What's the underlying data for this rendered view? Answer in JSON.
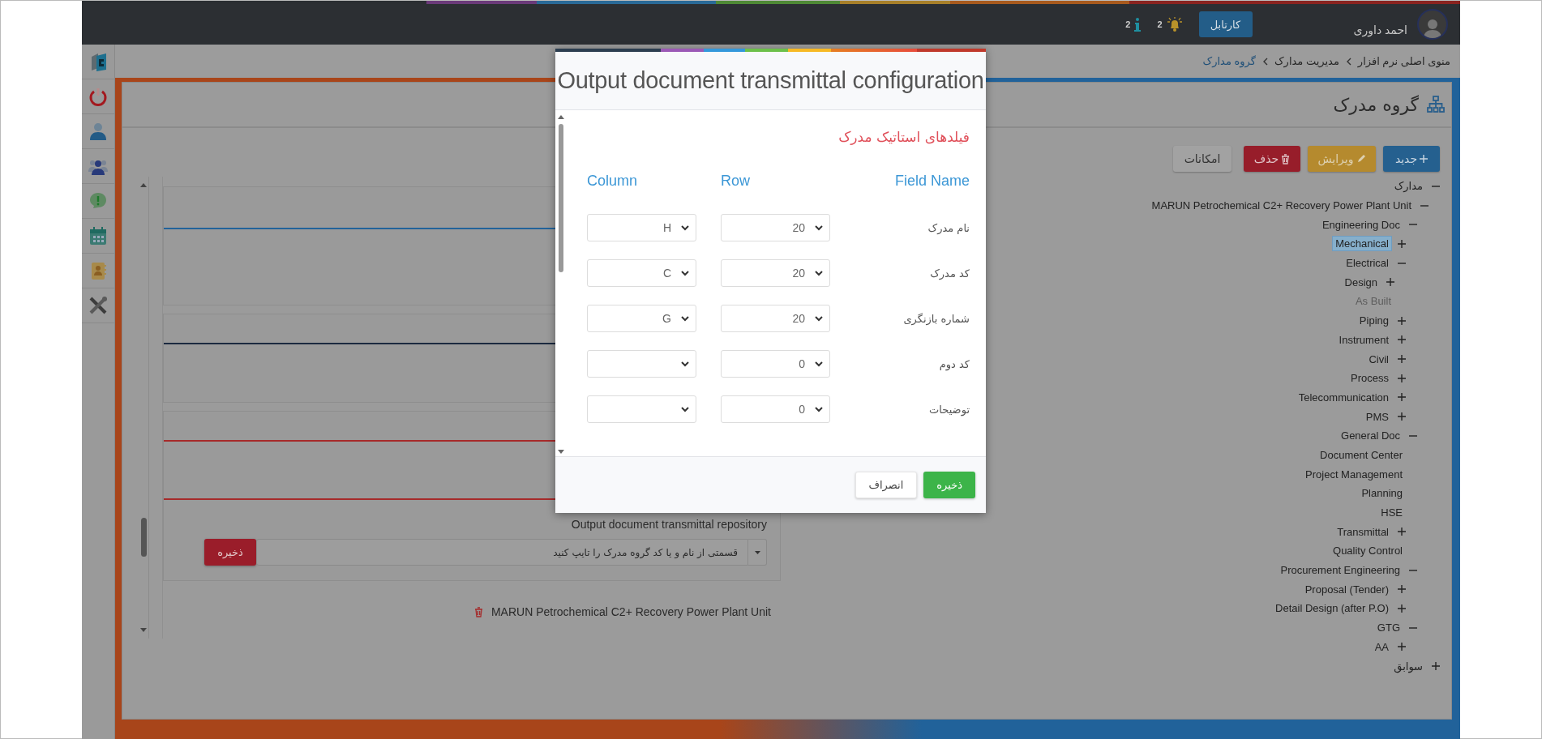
{
  "top_bar": {
    "user_name": "احمد داوری",
    "inbox_button": "کارتابل",
    "notifications_count": "2",
    "info_count": "2"
  },
  "breadcrumb": [
    {
      "label": "منوی اصلی نرم افزار",
      "current": false
    },
    {
      "label": "مدیریت مدارک",
      "current": false
    },
    {
      "label": "گروه مدارک",
      "current": true
    }
  ],
  "page": {
    "title": "گروه مدرک"
  },
  "toolbar": {
    "buttons": [
      {
        "kind": "new",
        "label": "جدید"
      },
      {
        "kind": "edit",
        "label": "ویرایش"
      },
      {
        "kind": "delete",
        "label": "حذف"
      },
      {
        "kind": "options",
        "label": "امکانات"
      }
    ]
  },
  "tree": [
    {
      "label": "مدارک",
      "expanded": true,
      "selected": false,
      "disabled": false,
      "children": [
        {
          "label": "MARUN Petrochemical C2+ Recovery Power Plant Unit",
          "expanded": true,
          "selected": false,
          "disabled": false,
          "children": [
            {
              "label": "Engineering Doc",
              "expanded": true,
              "selected": false,
              "disabled": false,
              "children": [
                {
                  "label": "Mechanical",
                  "expanded": false,
                  "selected": true,
                  "disabled": false
                },
                {
                  "label": "Electrical",
                  "expanded": true,
                  "selected": false,
                  "disabled": false,
                  "children": [
                    {
                      "label": "Design",
                      "expanded": false,
                      "selected": false,
                      "disabled": false
                    },
                    {
                      "label": "As Built",
                      "selected": false,
                      "disabled": true
                    }
                  ]
                },
                {
                  "label": "Piping",
                  "expanded": false,
                  "selected": false,
                  "disabled": false
                },
                {
                  "label": "Instrument",
                  "expanded": false,
                  "selected": false,
                  "disabled": false
                },
                {
                  "label": "Civil",
                  "expanded": false,
                  "selected": false,
                  "disabled": false
                },
                {
                  "label": "Process",
                  "expanded": false,
                  "selected": false,
                  "disabled": false
                },
                {
                  "label": "Telecommunication",
                  "expanded": false,
                  "selected": false,
                  "disabled": false
                },
                {
                  "label": "PMS",
                  "expanded": false,
                  "selected": false,
                  "disabled": false
                }
              ]
            },
            {
              "label": "General Doc",
              "expanded": true,
              "selected": false,
              "disabled": false,
              "children": [
                {
                  "label": "Document Center",
                  "selected": false,
                  "disabled": false
                },
                {
                  "label": "Project Management",
                  "selected": false,
                  "disabled": false
                },
                {
                  "label": "Planning",
                  "selected": false,
                  "disabled": false
                },
                {
                  "label": "HSE",
                  "selected": false,
                  "disabled": false
                },
                {
                  "label": "Transmittal",
                  "expanded": false,
                  "selected": false,
                  "disabled": false
                },
                {
                  "label": "Quality Control",
                  "selected": false,
                  "disabled": false
                }
              ]
            },
            {
              "label": "Procurement Engineering",
              "expanded": true,
              "selected": false,
              "disabled": false,
              "children": [
                {
                  "label": "Proposal (Tender)",
                  "expanded": false,
                  "selected": false,
                  "disabled": false
                },
                {
                  "label": "Detail Design (after P.O)",
                  "expanded": false,
                  "selected": false,
                  "disabled": false
                }
              ]
            },
            {
              "label": "GTG",
              "expanded": true,
              "selected": false,
              "disabled": false,
              "children": [
                {
                  "label": "AA",
                  "expanded": false,
                  "selected": false,
                  "disabled": false
                }
              ]
            }
          ]
        }
      ]
    },
    {
      "label": "سوابق",
      "expanded": false,
      "selected": false,
      "disabled": false
    }
  ],
  "left_panel": {
    "repository_label": "Output document transmittal repository",
    "search": {
      "placeholder": "قسمتی از نام و یا کد گروه مدرک را تایپ کنید"
    },
    "save_button": "ذخیره",
    "items": [
      {
        "label": "MARUN Petrochemical C2+ Recovery Power Plant Unit"
      }
    ]
  },
  "modal": {
    "title": "Output document transmittal configuration",
    "section_title": "فیلدهای استاتیک مدرک",
    "columns": [
      "Field Name",
      "Row",
      "Column"
    ],
    "rows": [
      {
        "field": "نام مدرک",
        "row": "20",
        "column": "H"
      },
      {
        "field": "کد مدرک",
        "row": "20",
        "column": "C"
      },
      {
        "field": "شماره بازنگری",
        "row": "20",
        "column": "G"
      },
      {
        "field": "کد دوم",
        "row": "0"
      },
      {
        "field": "توضیحات",
        "row": "0"
      }
    ],
    "buttons": [
      {
        "kind": "save",
        "label": "ذخیره"
      },
      {
        "kind": "cancel",
        "label": "انصراف"
      }
    ]
  }
}
